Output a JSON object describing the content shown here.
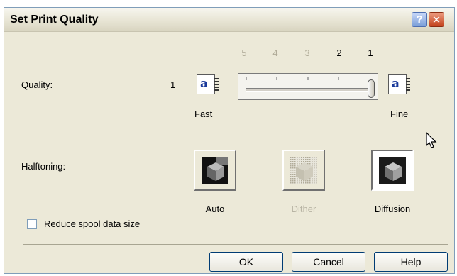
{
  "dialog": {
    "title": "Set Print Quality",
    "help_icon_label": "?",
    "close_icon_label": "✕"
  },
  "quality": {
    "label": "Quality:",
    "value": "1",
    "scale": [
      "5",
      "4",
      "3",
      "2",
      "1"
    ],
    "slider_level": 1,
    "fast_label": "Fast",
    "fine_label": "Fine",
    "sample_glyph": "a"
  },
  "halftoning": {
    "label": "Halftoning:",
    "options": [
      {
        "label": "Auto",
        "icon": "cube-auto-icon",
        "enabled": true
      },
      {
        "label": "Dither",
        "icon": "dither-icon",
        "enabled": false
      },
      {
        "label": "Diffusion",
        "icon": "cube-diffusion-icon",
        "enabled": true,
        "selected": true
      }
    ]
  },
  "reduce_spool": {
    "label": "Reduce spool data size",
    "checked": false
  },
  "buttons": {
    "ok": "OK",
    "cancel": "Cancel",
    "help": "Help"
  },
  "colors": {
    "dialog_bg": "#ece9d8",
    "button_border": "#003c74",
    "accent": "#1a3a9a"
  }
}
